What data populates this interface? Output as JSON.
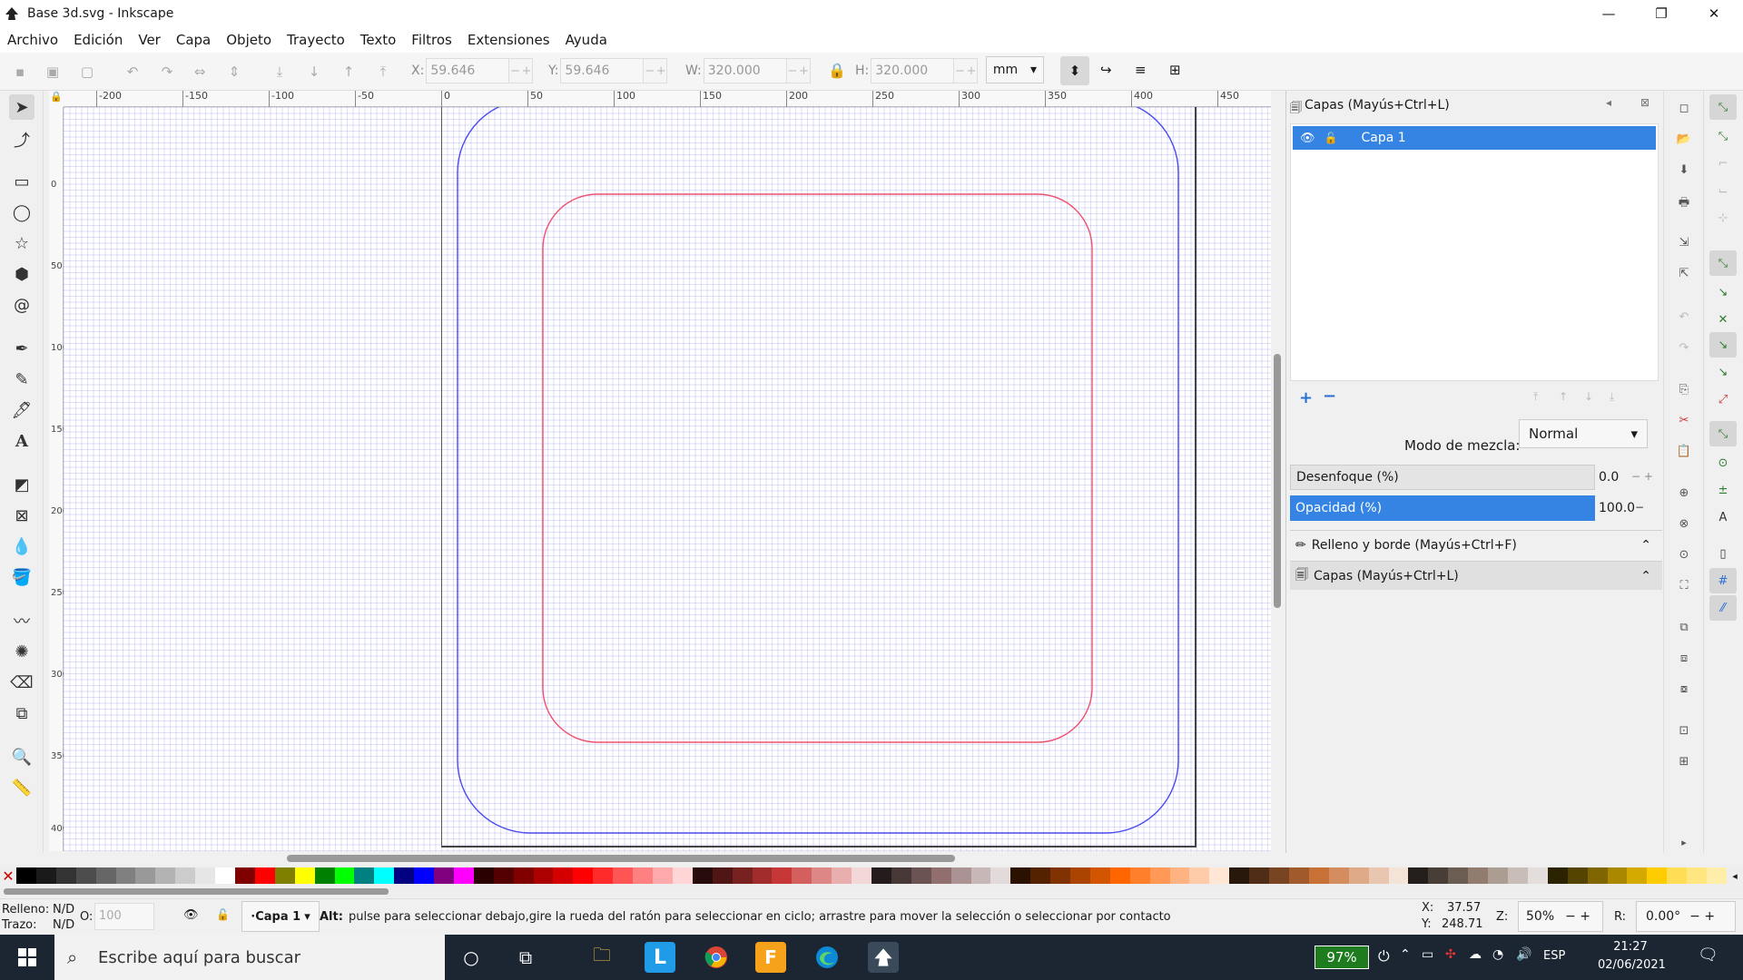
{
  "window": {
    "title": "Base 3d.svg - Inkscape",
    "min": "—",
    "max": "❐",
    "close": "✕"
  },
  "menu": [
    "Archivo",
    "Edición",
    "Ver",
    "Capa",
    "Objeto",
    "Trayecto",
    "Texto",
    "Filtros",
    "Extensiones",
    "Ayuda"
  ],
  "toolbar": {
    "x_label": "X:",
    "x_value": "59.646",
    "y_label": "Y:",
    "y_value": "59.646",
    "w_label": "W:",
    "w_value": "320.000",
    "h_label": "H:",
    "h_value": "320.000",
    "unit": "mm"
  },
  "ruler": {
    "h_ticks": [
      "-200",
      "-150",
      "-100",
      "-50",
      "0",
      "50",
      "100",
      "150",
      "200",
      "250",
      "300",
      "350",
      "400",
      "450"
    ],
    "v_ticks": [
      "0",
      "50",
      "100",
      "150",
      "200",
      "250",
      "300",
      "350",
      "400"
    ]
  },
  "canvas": {
    "outer_color": "#4a4af0",
    "inner_color": "#f0506e"
  },
  "layers_panel": {
    "title": "Capas (Mayús+Ctrl+L)",
    "layer_name": "Capa 1",
    "blend_label": "Modo de mezcla:",
    "blend_value": "Normal",
    "blur_label": "Desenfoque (%)",
    "blur_value": "0.0",
    "opacity_label": "Opacidad (%)",
    "opacity_value": "100.0",
    "section_fill": "Relleno y borde (Mayús+Ctrl+F)",
    "section_layers": "Capas (Mayús+Ctrl+L)"
  },
  "palette_colors": [
    "#000000",
    "#1a1a1a",
    "#333333",
    "#4d4d4d",
    "#666666",
    "#808080",
    "#999999",
    "#b3b3b3",
    "#cccccc",
    "#e6e6e6",
    "#ffffff",
    "#800000",
    "#ff0000",
    "#808000",
    "#ffff00",
    "#008000",
    "#00ff00",
    "#008080",
    "#00ffff",
    "#000080",
    "#0000ff",
    "#800080",
    "#ff00ff",
    "#2b0000",
    "#550000",
    "#800000",
    "#aa0000",
    "#d40000",
    "#ff0000",
    "#ff2a2a",
    "#ff5555",
    "#ff8080",
    "#ffaaaa",
    "#ffd5d5",
    "#280b0b",
    "#501616",
    "#782121",
    "#a02c2c",
    "#c83737",
    "#d35f5f",
    "#de8787",
    "#e9afaf",
    "#f4d7d7",
    "#241c1c",
    "#483737",
    "#6c5353",
    "#916f6f",
    "#ac9393",
    "#c8b7b7",
    "#e3dbdb",
    "#2b1100",
    "#552200",
    "#803300",
    "#aa4400",
    "#d45500",
    "#ff6600",
    "#ff7f2a",
    "#ff9955",
    "#ffb380",
    "#ffccaa",
    "#ffe6d5",
    "#28170b",
    "#502d16",
    "#784421",
    "#a05a2c",
    "#c87137",
    "#d38d5f",
    "#deaa87",
    "#e9c6af",
    "#f4e3d7",
    "#241f1c",
    "#483e37",
    "#6c5d53",
    "#917c6f",
    "#ac9d93",
    "#c8beb7",
    "#e3dedb",
    "#2b2200",
    "#554400",
    "#806600",
    "#aa8800",
    "#d4aa00",
    "#ffcc00",
    "#ffdd55",
    "#ffe680",
    "#ffeeaa"
  ],
  "status": {
    "fill_label": "Relleno:",
    "fill_value": "N/D",
    "stroke_label": "Trazo:",
    "stroke_value": "N/D",
    "opacity_o_label": "O:",
    "opacity_o_value": "100",
    "layer": "·Capa 1",
    "alt_key": "Alt:",
    "message": "pulse para seleccionar debajo,gire la rueda del ratón para seleccionar en ciclo; arrastre para mover la selección o seleccionar por contacto",
    "cursor_x_label": "X:",
    "cursor_x": "37.57",
    "cursor_y_label": "Y:",
    "cursor_y": "248.71",
    "zoom_label": "Z:",
    "zoom": "50%",
    "rotate_label": "R:",
    "rotate": "0.00°"
  },
  "taskbar": {
    "search_placeholder": "Escribe aquí para buscar",
    "battery": "97%",
    "lang": "ESP",
    "time": "21:27",
    "date": "02/06/2021"
  }
}
